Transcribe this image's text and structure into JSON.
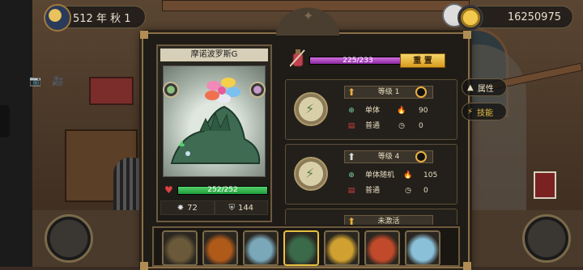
{
  "hud": {
    "date_label": "512 年 秋 1",
    "gold_amount": "16250975"
  },
  "monster": {
    "name": "摩诺波罗斯G",
    "hp_text": "252/252",
    "hp_fraction": 1.0,
    "attack": "72",
    "defense": "144"
  },
  "exp": {
    "text": "225/233",
    "fraction": 0.9657
  },
  "reset_label": "重 置",
  "tabs": [
    {
      "label": "属性",
      "icon": "triangle-stack-icon"
    },
    {
      "label": "技能",
      "icon": "lightning-icon"
    }
  ],
  "skills": [
    {
      "level": "等级 1",
      "target": "单体",
      "power": "90",
      "type": "普通",
      "cooldown": "0"
    },
    {
      "level": "等级 4",
      "target": "单体随机",
      "power": "105",
      "type": "普通",
      "cooldown": "0"
    },
    {
      "level": "未激活"
    }
  ],
  "colors": {
    "hp": "#2db04a",
    "exp": "#b04ad0",
    "gold_button": "#e8b840",
    "frame": "#8a7048"
  },
  "roster": [
    {
      "name": "slot-1",
      "color": "#6a5a3a"
    },
    {
      "name": "slot-2",
      "color": "#b05a1a"
    },
    {
      "name": "slot-3",
      "color": "#7aa8b8"
    },
    {
      "name": "slot-4",
      "color": "#3a6a4a"
    },
    {
      "name": "slot-5",
      "color": "#d0a030"
    },
    {
      "name": "slot-6",
      "color": "#c04a2a"
    },
    {
      "name": "slot-7",
      "color": "#8ac0d8"
    }
  ]
}
